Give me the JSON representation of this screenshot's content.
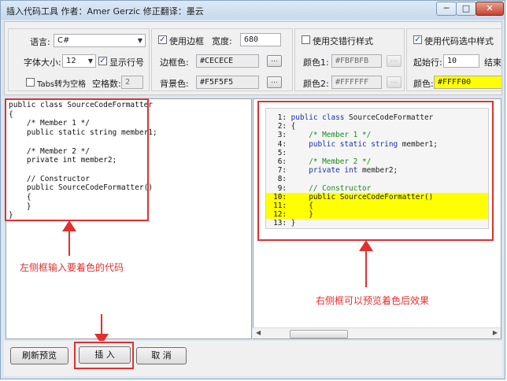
{
  "window": {
    "title": "插入代码工具 作者：Amer Gerzic 修正翻译：墨云",
    "minimize": "─",
    "maximize": "□",
    "close": "✕"
  },
  "settings": {
    "language_label": "语言:",
    "language_value": "C#",
    "font_size_label": "字体大小:",
    "font_size_value": "12",
    "show_line_numbers_label": "显示行号",
    "tabs_to_spaces_label": "Tabs转为空格",
    "space_count_label": "空格数:",
    "space_count_value": "2",
    "use_border_label": "使用边框",
    "width_label": "宽度:",
    "width_value": "680",
    "border_color_label": "边框色:",
    "border_color_value": "#CECECE",
    "bg_color_label": "背景色:",
    "bg_color_value": "#F5F5F5",
    "alt_row_label": "使用交错行样式",
    "color1_label": "颜色1:",
    "color1_value": "#FBFBFB",
    "color2_label": "颜色2:",
    "color2_value": "#FFFFFF",
    "highlight_label": "使用代码选中样式",
    "start_row_label": "起始行:",
    "start_row_value": "10",
    "end_label": "结束",
    "hl_color_label": "颜色:",
    "hl_color_value": "#FFFF00",
    "browse": "..."
  },
  "source_lines": [
    "public class SourceCodeFormatter",
    "{",
    "    /* Member 1 */",
    "    public static string member1;",
    "",
    "    /* Member 2 */",
    "    private int member2;",
    "",
    "    // Constructor",
    "    public SourceCodeFormatter()",
    "    {",
    "    }",
    "}"
  ],
  "preview_lines": [
    {
      "n": "1:",
      "kw": "public class",
      "rest": " SourceCodeFormatter",
      "cm": "",
      "hl": false
    },
    {
      "n": "2:",
      "kw": "",
      "rest": "{",
      "cm": "",
      "hl": false
    },
    {
      "n": "3:",
      "kw": "",
      "rest": "",
      "cm": "    /* Member 1 */",
      "hl": false
    },
    {
      "n": "4:",
      "kw": "    public static string",
      "rest": " member1;",
      "cm": "",
      "hl": false
    },
    {
      "n": "5:",
      "kw": "",
      "rest": "",
      "cm": "",
      "hl": false
    },
    {
      "n": "6:",
      "kw": "",
      "rest": "",
      "cm": "    /* Member 2 */",
      "hl": false
    },
    {
      "n": "7:",
      "kw": "    private int",
      "rest": " member2;",
      "cm": "",
      "hl": false
    },
    {
      "n": "8:",
      "kw": "",
      "rest": "",
      "cm": "",
      "hl": false
    },
    {
      "n": "9:",
      "kw": "",
      "rest": "",
      "cm": "    // Constructor",
      "hl": false
    },
    {
      "n": "10:",
      "kw": "",
      "rest": "    public SourceCodeFormatter()",
      "cm": "",
      "hl": true
    },
    {
      "n": "11:",
      "kw": "",
      "rest": "    {",
      "cm": "",
      "hl": true
    },
    {
      "n": "12:",
      "kw": "",
      "rest": "    }",
      "cm": "",
      "hl": true
    },
    {
      "n": "13:",
      "kw": "",
      "rest": "}",
      "cm": "",
      "hl": false
    }
  ],
  "annotations": {
    "left": "左侧框输入要着色的代码",
    "right": "右侧框可以预览着色后效果"
  },
  "buttons": {
    "refresh": "刷新预览",
    "insert": "插 入",
    "cancel": "取 消"
  },
  "scroll": {
    "left_arrow": "◀",
    "right_arrow": "▶"
  },
  "colors": {
    "annotation_red": "#E0302E",
    "highlight_yellow": "#FFFF00"
  }
}
